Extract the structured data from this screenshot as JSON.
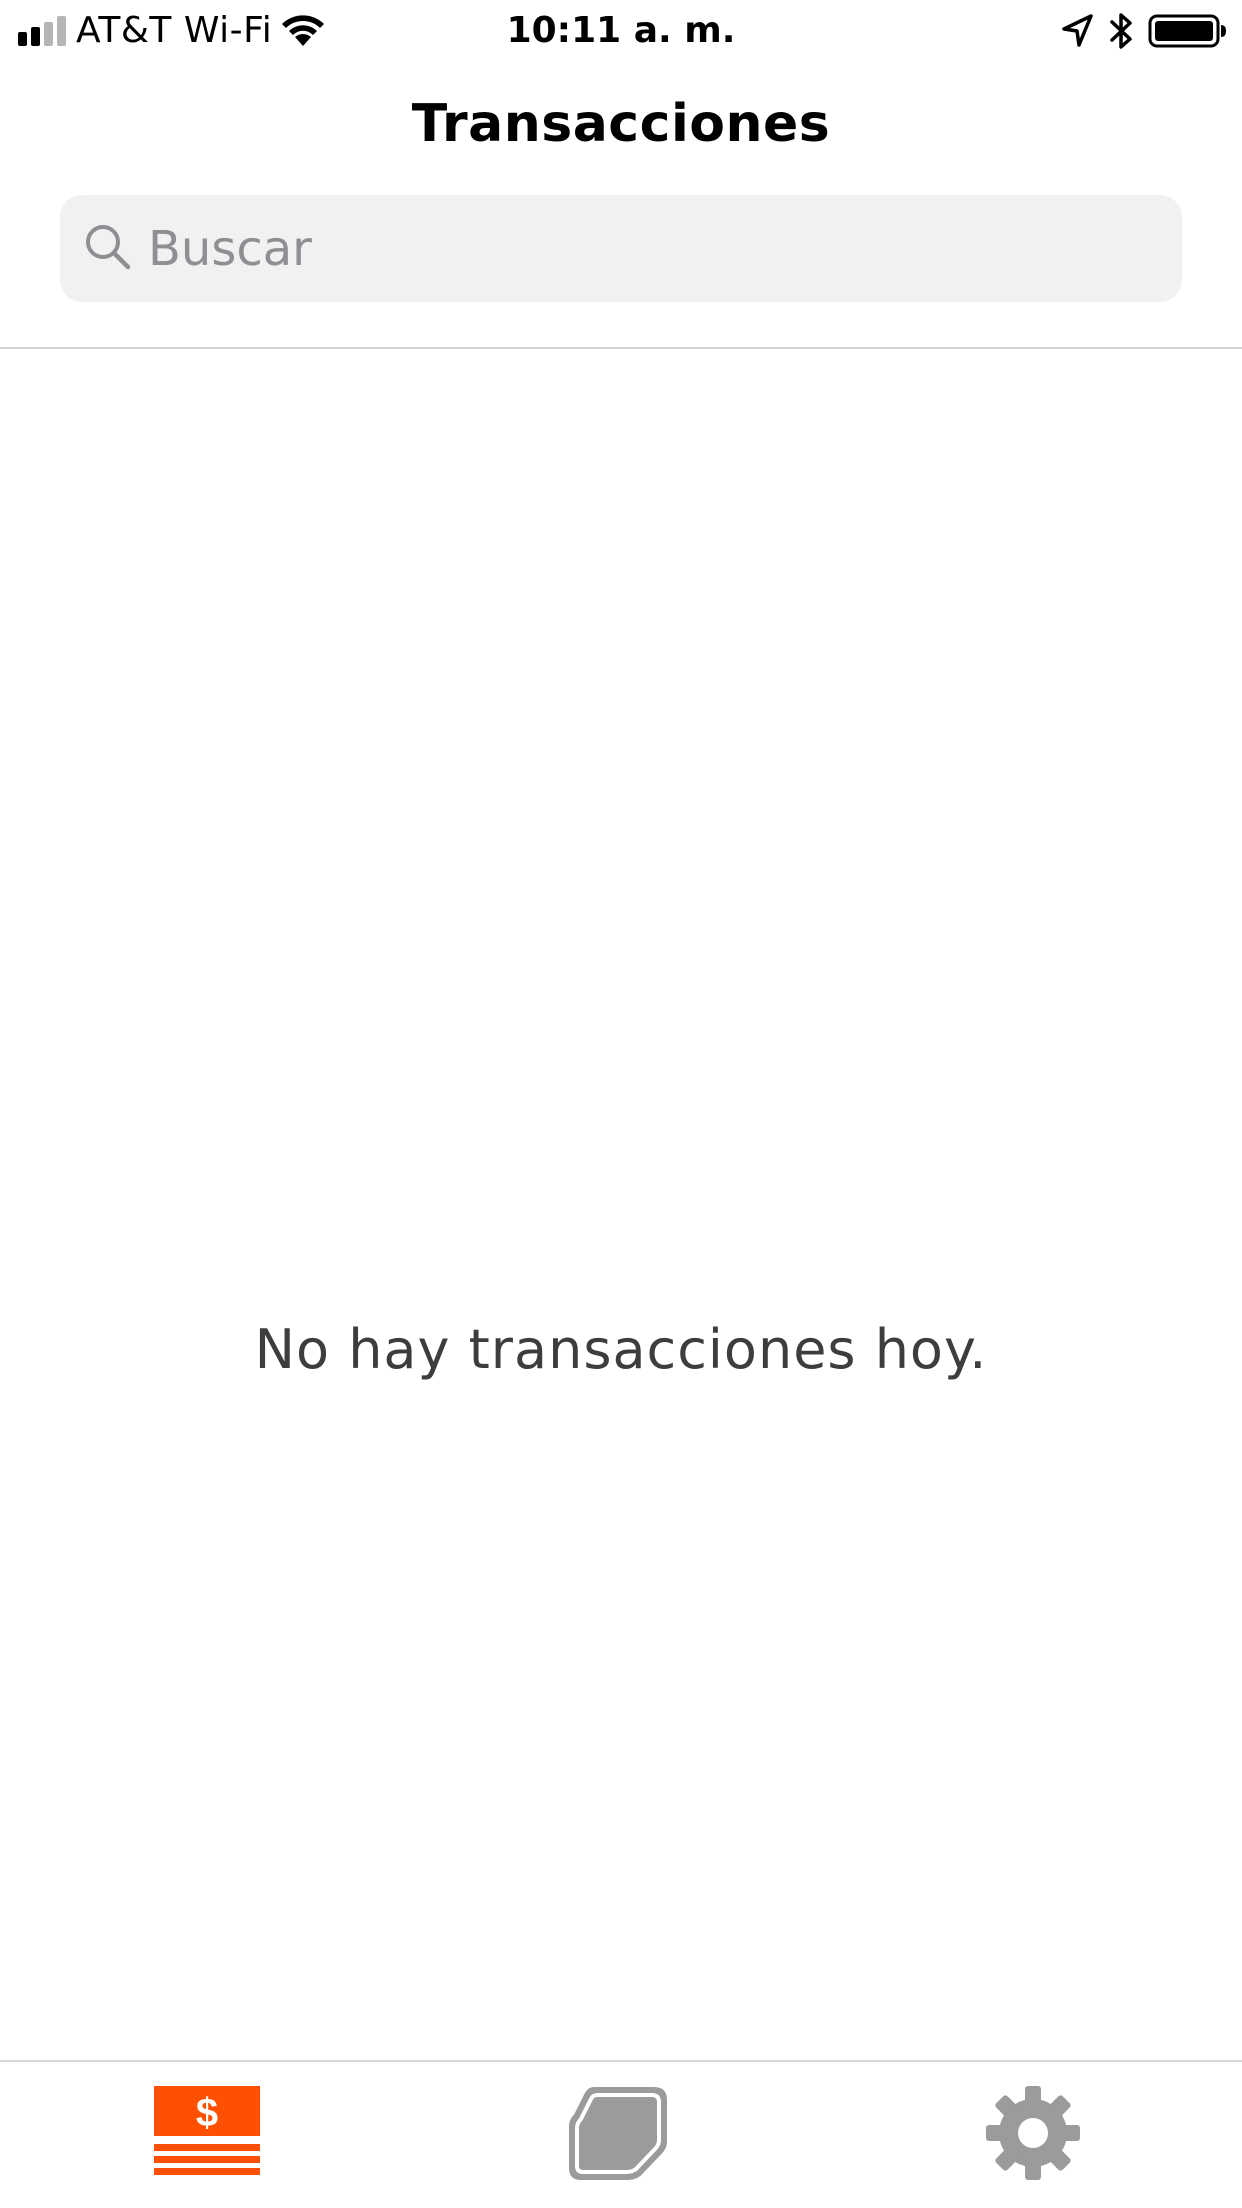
{
  "status_bar": {
    "carrier": "AT&T Wi-Fi",
    "time": "10:11 a. m.",
    "signal_bars_filled": 2,
    "signal_bars_total": 4
  },
  "nav": {
    "title": "Transacciones"
  },
  "search": {
    "placeholder": "Buscar",
    "value": ""
  },
  "empty_state": {
    "message": "No hay transacciones hoy."
  },
  "tab_bar": {
    "tabs": [
      {
        "name": "transactions",
        "icon": "dollar-bill-icon",
        "active": true
      },
      {
        "name": "card",
        "icon": "card-icon",
        "active": false
      },
      {
        "name": "settings",
        "icon": "gear-icon",
        "active": false
      }
    ]
  },
  "colors": {
    "accent": "#ff4f00",
    "inactive_icon": "#9b9b9b",
    "search_bg": "#f1f1f1",
    "placeholder": "#8e8e93",
    "message_text": "#3d3d3d"
  }
}
